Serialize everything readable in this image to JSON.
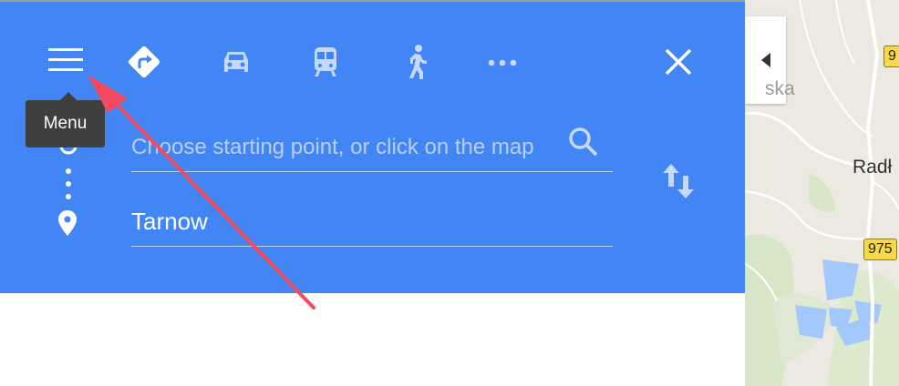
{
  "toolbar": {
    "menu_icon": "hamburger-menu-icon",
    "modes": [
      "best-route-icon",
      "car-icon",
      "transit-icon",
      "walking-icon",
      "more-options-icon"
    ],
    "close_icon": "close-icon"
  },
  "tooltip": {
    "label": "Menu"
  },
  "directions": {
    "start_placeholder": "Choose starting point, or click on the map",
    "destination": "Tarnow",
    "search_icon": "search-icon",
    "swap_icon": "swap-icon"
  },
  "map": {
    "labels": [
      "ska",
      "Radł"
    ],
    "road_shields": [
      "9",
      "975"
    ],
    "collapse_icon": "collapse-left-icon"
  },
  "colors": {
    "panel": "#4285f4",
    "annotation_arrow": "#f24a5e",
    "tooltip": "#3f3f3f"
  }
}
